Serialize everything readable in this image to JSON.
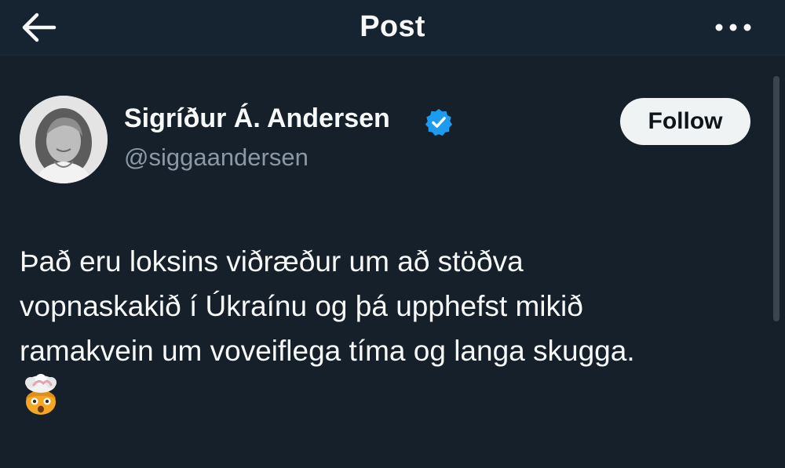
{
  "header": {
    "title": "Post",
    "back_icon": "arrow-left-icon",
    "more_icon": "more-horizontal-icon"
  },
  "author": {
    "name": "Sigríður Á. Andersen",
    "handle": "@siggaandersen",
    "verified": true,
    "verified_color": "#1d9bf0"
  },
  "follow_button": {
    "label": "Follow"
  },
  "post": {
    "lines": [
      "Það eru loksins viðræður um að stöðva",
      "vopnaskakið í Úkraínu og þá upphefst mikið",
      "ramakvein um voveiflega tíma og langa skugga."
    ],
    "emoji": "exploding-head-emoji"
  },
  "colors": {
    "background": "#15202b",
    "text": "#f7f9f9",
    "secondary_text": "#8b98a5",
    "button_bg": "#eff3f4"
  }
}
